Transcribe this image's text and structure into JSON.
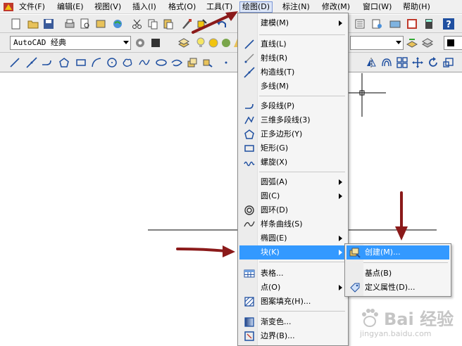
{
  "menubar": {
    "items": [
      {
        "label": "文件(F)"
      },
      {
        "label": "编辑(E)"
      },
      {
        "label": "视图(V)"
      },
      {
        "label": "插入(I)"
      },
      {
        "label": "格式(O)"
      },
      {
        "label": "工具(T)"
      },
      {
        "label": "绘图(D)"
      },
      {
        "label": "标注(N)"
      },
      {
        "label": "修改(M)"
      },
      {
        "label": "窗口(W)"
      },
      {
        "label": "帮助(H)"
      }
    ],
    "active_index": 6
  },
  "toolbar": {
    "workspace_combo": "AutoCAD 经典",
    "help_icon_text": "?"
  },
  "draw_menu": {
    "items": [
      {
        "label": "建模(M)",
        "icon": "none",
        "submenu": true
      },
      {
        "separator": true
      },
      {
        "label": "直线(L)",
        "icon": "line-icon"
      },
      {
        "label": "射线(R)",
        "icon": "ray-icon"
      },
      {
        "label": "构造线(T)",
        "icon": "construction-line-icon"
      },
      {
        "label": "多线(M)",
        "icon": "none"
      },
      {
        "separator": true
      },
      {
        "label": "多段线(P)",
        "icon": "polyline-icon"
      },
      {
        "label": "三维多段线(3)",
        "icon": "3d-polyline-icon"
      },
      {
        "label": "正多边形(Y)",
        "icon": "polygon-icon"
      },
      {
        "label": "矩形(G)",
        "icon": "rectangle-icon"
      },
      {
        "label": "螺旋(X)",
        "icon": "helix-icon"
      },
      {
        "separator": true
      },
      {
        "label": "圆弧(A)",
        "icon": "none",
        "submenu": true
      },
      {
        "label": "圆(C)",
        "icon": "none",
        "submenu": true
      },
      {
        "label": "圆环(D)",
        "icon": "donut-icon"
      },
      {
        "label": "样条曲线(S)",
        "icon": "spline-icon"
      },
      {
        "label": "椭圆(E)",
        "icon": "none",
        "submenu": true
      },
      {
        "label": "块(K)",
        "icon": "none",
        "submenu": true,
        "highlighted": true
      },
      {
        "separator": true
      },
      {
        "label": "表格...",
        "icon": "table-icon"
      },
      {
        "label": "点(O)",
        "icon": "none",
        "submenu": true
      },
      {
        "label": "图案填充(H)...",
        "icon": "hatch-icon"
      },
      {
        "separator": true
      },
      {
        "label": "渐变色...",
        "icon": "gradient-icon"
      },
      {
        "label": "边界(B)...",
        "icon": "boundary-icon"
      }
    ]
  },
  "block_submenu": {
    "items": [
      {
        "label": "创建(M)...",
        "icon": "block-create-icon",
        "highlighted": true
      },
      {
        "separator": true
      },
      {
        "label": "基点(B)",
        "icon": "none"
      },
      {
        "label": "定义属性(D)...",
        "icon": "define-attribute-icon"
      }
    ]
  },
  "watermark": {
    "text": "Bai 经验",
    "url": "jingyan.baidu.com"
  },
  "colors": {
    "highlight": "#3399ff",
    "annotation_arrow": "#8b1a1a",
    "toolbar_bg": "#ececec",
    "menu_bg": "#f5f5f5"
  }
}
